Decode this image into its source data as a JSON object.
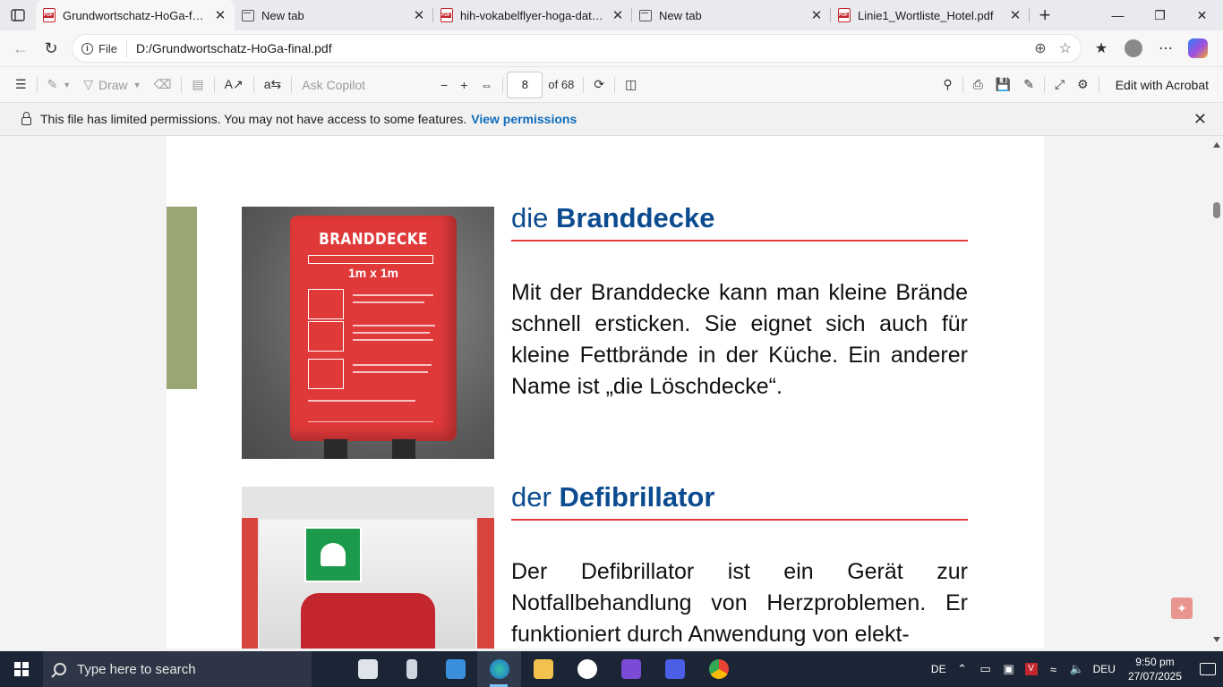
{
  "browser": {
    "tabs": [
      {
        "title": "Grundwortschatz-HoGa-final.p",
        "type": "pdf",
        "active": true
      },
      {
        "title": "New tab",
        "type": "newtab",
        "active": false
      },
      {
        "title": "hih-vokabelflyer-hoga-data.p",
        "type": "pdf",
        "active": false
      },
      {
        "title": "New tab",
        "type": "newtab",
        "active": false
      },
      {
        "title": "Linie1_Wortliste_Hotel.pdf",
        "type": "pdf",
        "active": false
      }
    ],
    "address": {
      "scheme_label": "File",
      "url": "D:/Grundwortschatz-HoGa-final.pdf"
    }
  },
  "pdf_toolbar": {
    "draw_label": "Draw",
    "ask_copilot_label": "Ask Copilot",
    "current_page": "8",
    "of_pages": "of 68",
    "edit_acrobat_label": "Edit with Acrobat"
  },
  "permission_bar": {
    "message": "This file has limited permissions. You may not have access to some features.",
    "link": "View permissions"
  },
  "document": {
    "entry1": {
      "article": "die",
      "word": "Branddecke",
      "text": "Mit der Branddecke kann man kleine Brände schnell ersticken. Sie eignet sich auch für kleine Fettbrände in der Küche. Ein anderer Name ist „die Löschdecke“.",
      "photo_label_title": "BRANDDECKE",
      "photo_label_size": "1m x 1m"
    },
    "entry2": {
      "article": "der",
      "word": "Defibrillator",
      "text": "Der Defibrillator ist ein Gerät zur Notfallbehandlung von Herzproblemen. Er funktioniert durch Anwendung von elekt-"
    }
  },
  "taskbar": {
    "search_placeholder": "Type here to search",
    "language": "DE",
    "input_lang": "DEU",
    "time": "9:50 pm",
    "date": "27/07/2025"
  }
}
